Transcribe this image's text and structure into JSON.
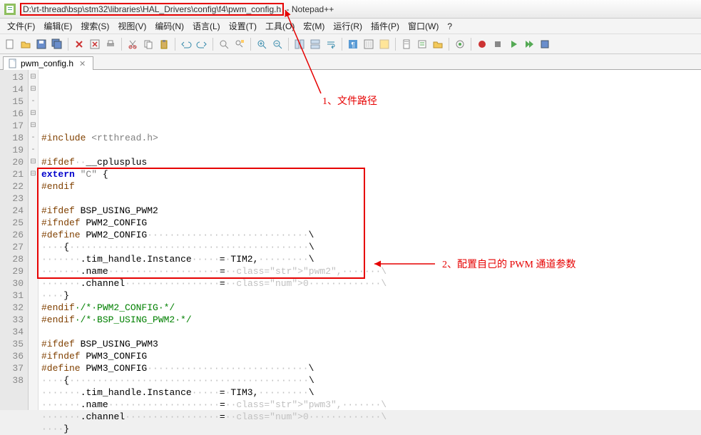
{
  "titlebar": {
    "path": "D:\\rt-thread\\bsp\\stm32\\libraries\\HAL_Drivers\\config\\f4\\pwm_config.h",
    "suffix": " - Notepad++"
  },
  "menu": {
    "file": "文件(F)",
    "edit": "编辑(E)",
    "search": "搜索(S)",
    "view": "视图(V)",
    "encoding": "编码(N)",
    "lang": "语言(L)",
    "settings": "设置(T)",
    "tools": "工具(O)",
    "macro": "宏(M)",
    "run": "运行(R)",
    "plugins": "插件(P)",
    "window": "窗口(W)",
    "help": "?"
  },
  "tab": {
    "name": "pwm_config.h"
  },
  "gutter": {
    "start": 13,
    "end": 38
  },
  "annotations": {
    "a1": "1、文件路径",
    "a2": "2、配置自己的 PWM 通道参数"
  },
  "code_lines": [
    {
      "n": 13,
      "t": ""
    },
    {
      "n": 14,
      "t": "#include <rtthread.h>",
      "pp": true
    },
    {
      "n": 15,
      "t": ""
    },
    {
      "n": 16,
      "t": "#ifdef  __cplusplus",
      "pp": true,
      "fold": "⊟"
    },
    {
      "n": 17,
      "t": "extern \"C\" {",
      "ext": true,
      "fold": "⊟"
    },
    {
      "n": 18,
      "t": "#endif",
      "pp": true,
      "fold": "-"
    },
    {
      "n": 19,
      "t": ""
    },
    {
      "n": 20,
      "t": "#ifdef BSP_USING_PWM2",
      "pp": true,
      "fold": "⊟"
    },
    {
      "n": 21,
      "t": "#ifndef PWM2_CONFIG",
      "pp": true,
      "fold": "⊟"
    },
    {
      "n": 22,
      "t": "#define PWM2_CONFIG                             \\",
      "pp": true
    },
    {
      "n": 23,
      "t": "    {                                           \\"
    },
    {
      "n": 24,
      "t": "       .tim_handle.Instance     = TIM2,         \\"
    },
    {
      "n": 25,
      "t": "       .name                    = \"pwm2\",       \\"
    },
    {
      "n": 26,
      "t": "       .channel                 = 0             \\"
    },
    {
      "n": 27,
      "t": "    }"
    },
    {
      "n": 28,
      "t": "#endif /* PWM2_CONFIG */",
      "pp": true,
      "cm": " /* PWM2_CONFIG */",
      "fold": "-"
    },
    {
      "n": 29,
      "t": "#endif /* BSP_USING_PWM2 */",
      "pp": true,
      "cm": " /* BSP_USING_PWM2 */",
      "fold": "-"
    },
    {
      "n": 30,
      "t": ""
    },
    {
      "n": 31,
      "t": "#ifdef BSP_USING_PWM3",
      "pp": true,
      "fold": "⊟"
    },
    {
      "n": 32,
      "t": "#ifndef PWM3_CONFIG",
      "pp": true,
      "fold": "⊟"
    },
    {
      "n": 33,
      "t": "#define PWM3_CONFIG                             \\",
      "pp": true
    },
    {
      "n": 34,
      "t": "    {                                           \\"
    },
    {
      "n": 35,
      "t": "       .tim_handle.Instance     = TIM3,         \\"
    },
    {
      "n": 36,
      "t": "       .name                    = \"pwm3\",       \\"
    },
    {
      "n": 37,
      "t": "       .channel                 = 0             \\"
    },
    {
      "n": 38,
      "t": "    }"
    }
  ]
}
